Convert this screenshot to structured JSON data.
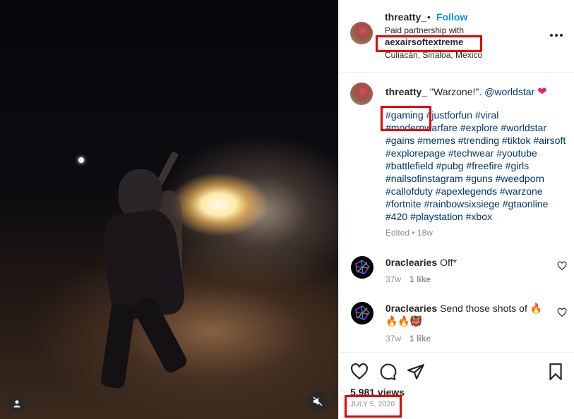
{
  "post": {
    "username": "threatty_",
    "separator": "•",
    "follow_label": "Follow",
    "paid_partnership_label": "Paid partnership with",
    "partner": "aexairsoftextreme",
    "location": "Culiacán, Sinaloa, Mexico"
  },
  "caption": {
    "username": "threatty_",
    "quote": "\"Warzone!\".",
    "mention": "@worldstar",
    "emoji": "❤",
    "hashtags": "#gaming #justforfun #viral #modernwarfare #explore #worldstar #gains #memes #trending #tiktok #airsoft #explorepage #techwear #youtube #battlefield #pubg #freefire #girls #nailsofinstagram #guns #weedporn #callofduty #apexlegends #warzone #fortnite #rainbowsixsiege #gtaonline #420 #playstation #xbox",
    "meta": "Edited • 18w"
  },
  "comments": [
    {
      "username": "0raclearies",
      "text": "Off*",
      "age": "37w",
      "likes": "1 like"
    },
    {
      "username": "0raclearies",
      "text": "Send those shots of 🔥 🔥🔥👹",
      "age": "37w",
      "likes": "1 like"
    }
  ],
  "footer": {
    "views": "5,981 views",
    "date": "JULY 5, 2020"
  },
  "colors": {
    "accent": "#0095f6",
    "link": "#00376b",
    "highlight": "#e60000",
    "muted": "#8e8e8e"
  },
  "icons": [
    "user-icon",
    "mute-icon",
    "more-icon",
    "heart-icon",
    "comment-icon",
    "share-icon",
    "save-icon"
  ]
}
